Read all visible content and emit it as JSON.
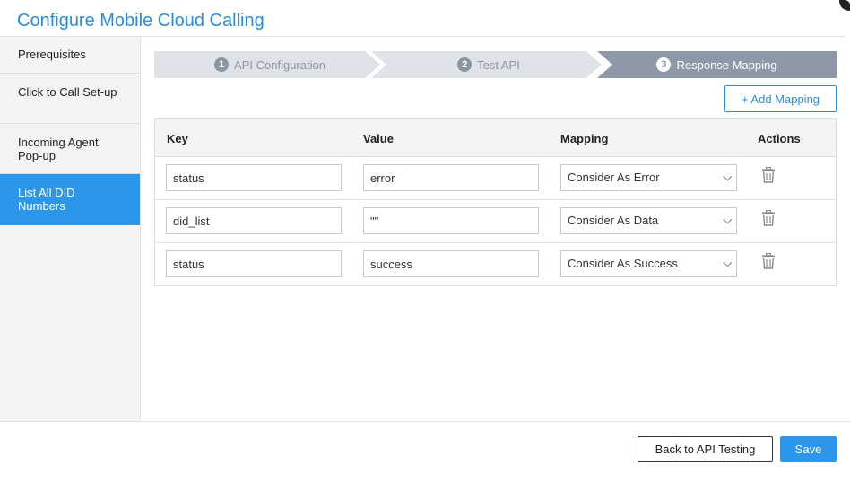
{
  "dialog": {
    "title": "Configure Mobile Cloud Calling"
  },
  "sidebar": {
    "items": [
      {
        "label": "Prerequisites",
        "active": false
      },
      {
        "label": "Click to Call Set-up",
        "active": false
      },
      {
        "label": "Incoming Agent Pop-up",
        "active": false
      },
      {
        "label": "List All DID Numbers",
        "active": true
      }
    ]
  },
  "steps": [
    {
      "number": "1",
      "label": "API Configuration",
      "active": false
    },
    {
      "number": "2",
      "label": "Test API",
      "active": false
    },
    {
      "number": "3",
      "label": "Response Mapping",
      "active": true
    }
  ],
  "toolbar": {
    "add_mapping_label": "+ Add Mapping"
  },
  "table": {
    "columns": [
      "Key",
      "Value",
      "Mapping",
      "Actions"
    ],
    "rows": [
      {
        "key": "status",
        "value": "error",
        "mapping": "Consider As Error",
        "action_icon": "trash-icon"
      },
      {
        "key": "did_list",
        "value": "\"\"",
        "mapping": "Consider As Data",
        "action_icon": "trash-icon"
      },
      {
        "key": "status",
        "value": "success",
        "mapping": "Consider As Success",
        "action_icon": "trash-icon"
      }
    ]
  },
  "footer": {
    "back_label": "Back to API Testing",
    "save_label": "Save"
  },
  "colors": {
    "accent": "#2c97ea",
    "title": "#2a8ed6",
    "active_step": "#8e98a8",
    "inactive_step": "#dfe3e8"
  }
}
